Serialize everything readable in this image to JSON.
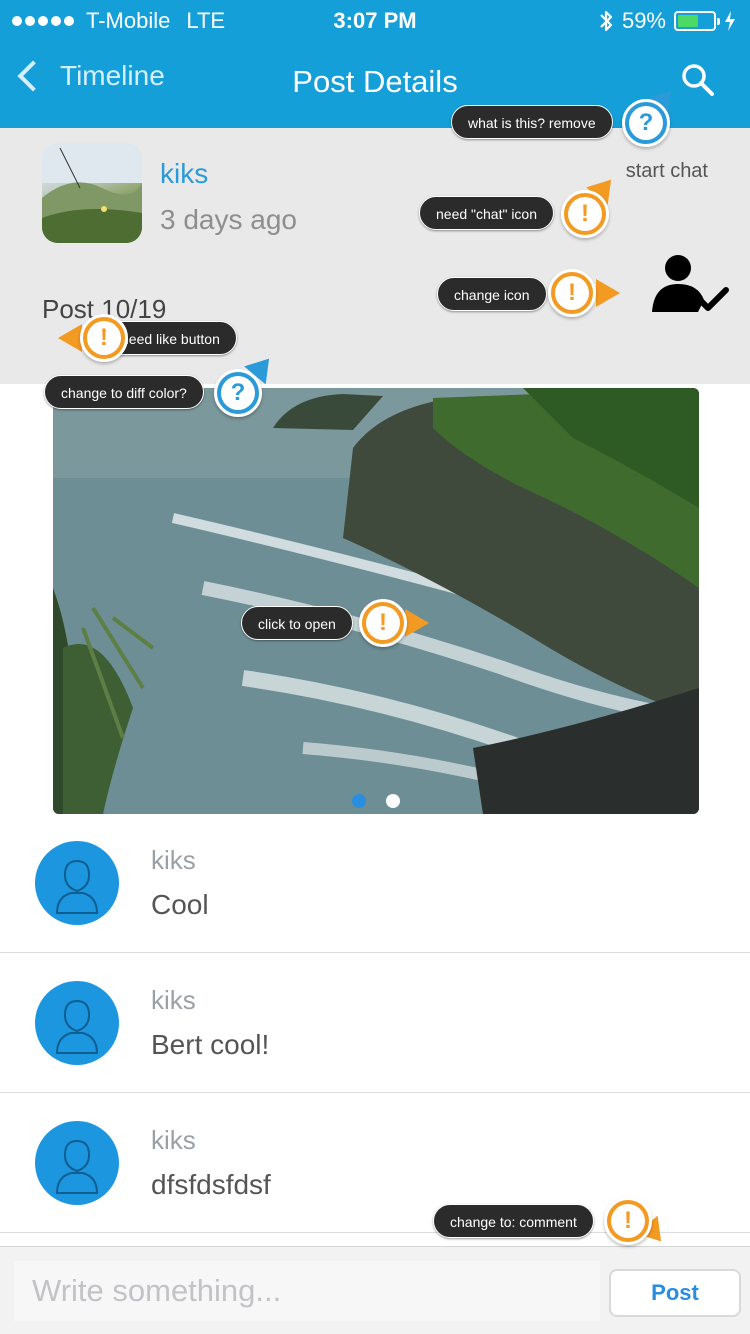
{
  "status_bar": {
    "carrier": "T-Mobile",
    "network": "LTE",
    "time": "3:07 PM",
    "battery_percent_label": "59%",
    "battery_level": 0.59
  },
  "nav": {
    "back_label": "Timeline",
    "title": "Post Details"
  },
  "post": {
    "user": "kiks",
    "time_ago": "3 days ago",
    "start_chat_label": "start chat",
    "title": "Post 10/19",
    "pager": {
      "count": 2,
      "active": 0
    }
  },
  "comments": [
    {
      "name": "kiks",
      "text": "Cool"
    },
    {
      "name": "kiks",
      "text": "Bert cool!"
    },
    {
      "name": "kiks",
      "text": "dfsfdsfdsf"
    }
  ],
  "composer": {
    "placeholder": "Write something...",
    "post_label": "Post"
  },
  "annotations": {
    "search": "what is this? remove",
    "chat": "need \"chat\" icon",
    "icon": "change icon",
    "like": "need like button",
    "color": "change to diff color?",
    "open": "click to open",
    "comment": "change to: comment"
  },
  "colors": {
    "nav_bg": "#159fd8",
    "accent": "#2a9bd8",
    "warn": "#f39a23",
    "header_bg": "#e9e9ea"
  }
}
